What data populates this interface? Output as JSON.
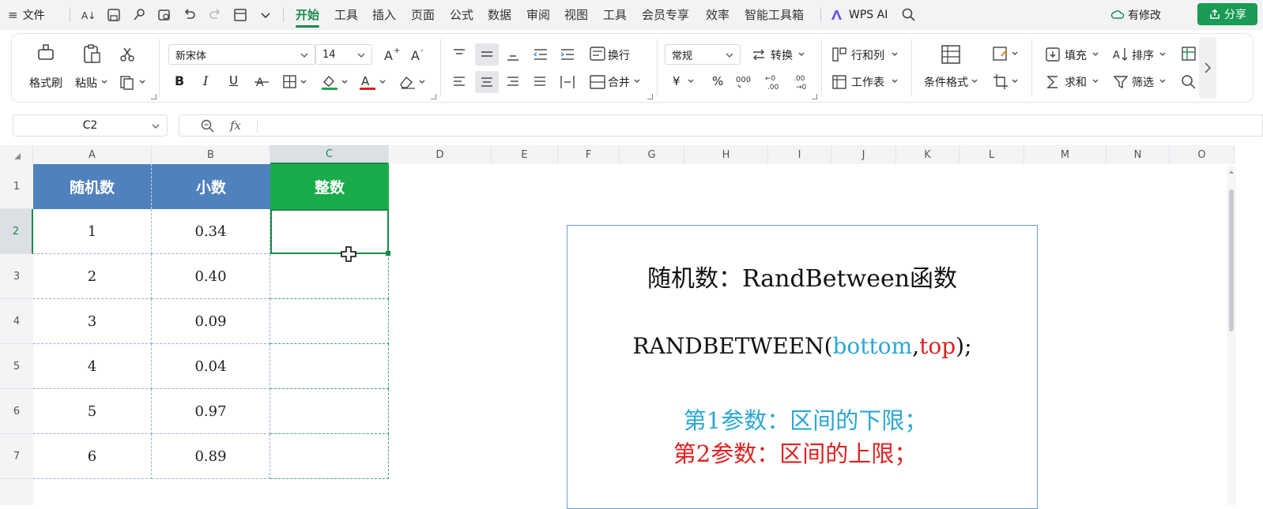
{
  "menubar": {
    "menu_icon": "≡",
    "file_label": "文件",
    "tabs": [
      "开始",
      "工具",
      "插入",
      "页面",
      "公式",
      "数据",
      "审阅",
      "视图",
      "工具",
      "会员专享",
      "效率",
      "智能工具箱"
    ],
    "active_tab": "开始",
    "wps_ai_label": "WPS AI",
    "modified_label": "有修改",
    "share_label": "分享"
  },
  "ribbon": {
    "format_painter": "格式刷",
    "paste": "粘贴",
    "font_name": "新宋体",
    "font_size": "14",
    "wrap_text": "换行",
    "merge": "合并",
    "number_format": "常规",
    "convert": "转换",
    "rows_cols": "行和列",
    "worksheet": "工作表",
    "cond_format": "条件格式",
    "fill": "填充",
    "sort": "排序",
    "sum": "求和",
    "filter": "筛选",
    "bold": "B",
    "italic": "I",
    "underline": "U",
    "percent": "%",
    "yen": "¥"
  },
  "formula_bar": {
    "cell_ref": "C2",
    "fx": "fx",
    "formula": ""
  },
  "grid": {
    "columns": [
      "A",
      "B",
      "C",
      "D",
      "E",
      "F",
      "G",
      "H",
      "I",
      "J",
      "K",
      "L",
      "M",
      "N",
      "O"
    ],
    "rows": [
      "1",
      "2",
      "3",
      "4",
      "5",
      "6",
      "7"
    ],
    "selected_cell": "C2",
    "headers": [
      "随机数",
      "小数",
      "整数"
    ],
    "header_colors": [
      "#4f81bd",
      "#4f81bd",
      "#1aab4b"
    ],
    "data": [
      [
        "1",
        "0.34",
        ""
      ],
      [
        "2",
        "0.40",
        ""
      ],
      [
        "3",
        "0.09",
        ""
      ],
      [
        "4",
        "0.04",
        ""
      ],
      [
        "5",
        "0.97",
        ""
      ],
      [
        "6",
        "0.89",
        ""
      ]
    ]
  },
  "textbox": {
    "title": "随机数：RandBetween函数",
    "syntax_prefix": "RANDBETWEEN(",
    "syntax_arg1": "bottom",
    "syntax_comma": ",",
    "syntax_arg2": "top",
    "syntax_suffix": ");",
    "param1": "第1参数：区间的下限；",
    "param2": "第2参数：区间的上限；",
    "colors": {
      "arg1": "#2ba7d3",
      "arg2": "#e02020"
    }
  }
}
